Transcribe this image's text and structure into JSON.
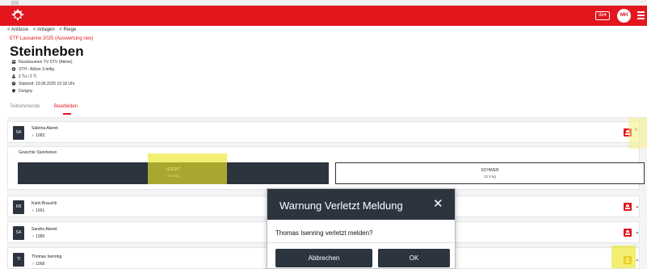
{
  "header": {
    "lang": "de",
    "user_initials": "MH",
    "brand_color": "#e3161e",
    "dark_color": "#2c3440"
  },
  "breadcrumb": [
    "< Anlässe",
    "< Anlagen",
    "< Riege"
  ],
  "event": "ETF Lausanne 2025 (Auswertung neu)",
  "title": "Steinheben",
  "meta": {
    "club": "Nussbaumen TV STV (Aktive)",
    "category": "STH - Aktive 3-teilig",
    "participants": "2 Tu / 2 Ti",
    "start": "Startzeit: 19.06.2025 10:18 Uhr",
    "location": "Dorigny"
  },
  "tabs": {
    "participants": "Teilnehmende",
    "edit": "Bearbeiten"
  },
  "rows": [
    {
      "initials": "SA",
      "name": "Sabrina Akeret",
      "gender": "♀",
      "year": "1983",
      "chevron": "^"
    },
    {
      "initials": "KB",
      "name": "Karin Brauchli",
      "gender": "♀",
      "year": "1991",
      "chevron": "⌄"
    },
    {
      "initials": "SA",
      "name": "Sandro Akeret",
      "gender": "♂",
      "year": "1985",
      "chevron": "⌄"
    },
    {
      "initials": "TI",
      "name": "Thomas Isenring",
      "gender": "♂",
      "year": "1968",
      "chevron": "⌄"
    }
  ],
  "weights": {
    "label": "Gewichte Steinheben",
    "light_label": "LEICHT",
    "light_weight": "10.0 kg",
    "heavy_label": "SCHWER",
    "heavy_weight": "12.5 kg"
  },
  "modal": {
    "title": "Warnung Verletzt Meldung",
    "close": "✕",
    "message": "Thomas Isenring verletzt melden?",
    "cancel": "Abbrechen",
    "ok": "OK"
  }
}
